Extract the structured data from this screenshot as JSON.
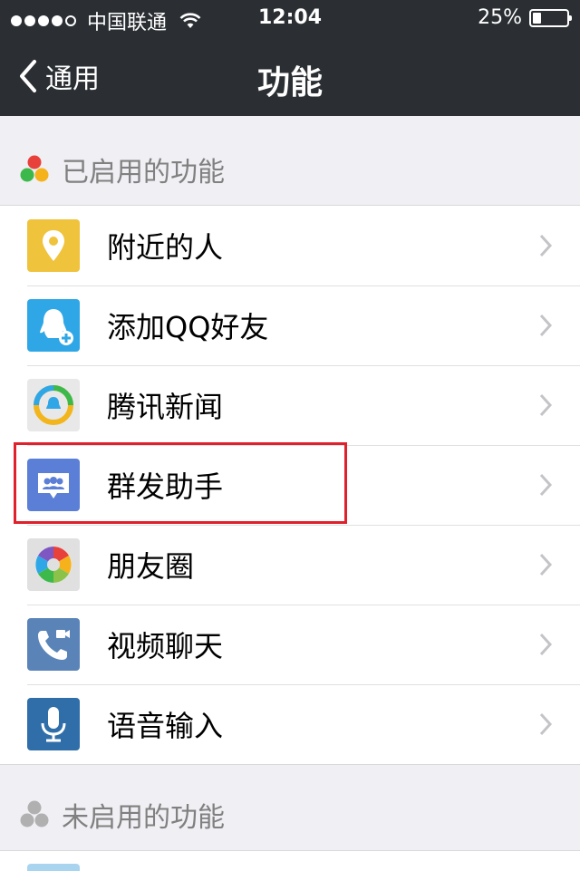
{
  "status": {
    "carrier": "中国联通",
    "time": "12:04",
    "battery": "25%",
    "battery_level": 0.25
  },
  "nav": {
    "back_label": "通用",
    "title": "功能"
  },
  "enabled": {
    "title": "已启用的功能",
    "items": [
      {
        "label": "附近的人"
      },
      {
        "label": "添加QQ好友"
      },
      {
        "label": "腾讯新闻"
      },
      {
        "label": "群发助手"
      },
      {
        "label": "朋友圈"
      },
      {
        "label": "视频聊天"
      },
      {
        "label": "语音输入"
      }
    ]
  },
  "disabled": {
    "title": "未启用的功能"
  },
  "colors": {
    "bar": "#2b2f33",
    "background": "#efeff4",
    "highlight": "#e0202b"
  }
}
